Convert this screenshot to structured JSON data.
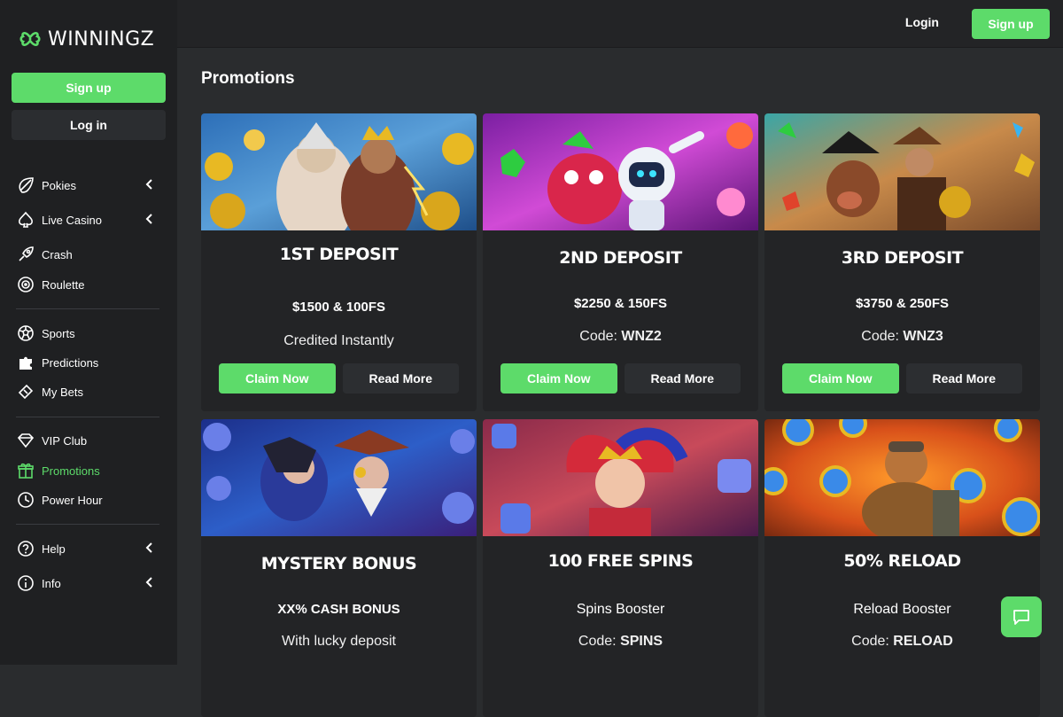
{
  "brand": {
    "name": "WINNINGZ",
    "accent": "#5ddb6a"
  },
  "sidebar": {
    "signup_label": "Sign up",
    "login_label": "Log in",
    "items": [
      {
        "label": "Pokies",
        "icon": "rocket-icon",
        "has_chevron": true
      },
      {
        "label": "Live Casino",
        "icon": "spade-icon",
        "has_chevron": true
      },
      {
        "label": "Crash",
        "icon": "rocket-launch-icon",
        "has_chevron": false
      },
      {
        "label": "Roulette",
        "icon": "roulette-icon",
        "has_chevron": false
      },
      {
        "label": "Sports",
        "icon": "soccer-ball-icon",
        "has_chevron": false
      },
      {
        "label": "Predictions",
        "icon": "puzzle-icon",
        "has_chevron": false
      },
      {
        "label": "My Bets",
        "icon": "ticket-icon",
        "has_chevron": false
      },
      {
        "label": "VIP Club",
        "icon": "diamond-icon",
        "has_chevron": false
      },
      {
        "label": "Promotions",
        "icon": "gift-icon",
        "has_chevron": false,
        "active": true
      },
      {
        "label": "Power Hour",
        "icon": "clock-icon",
        "has_chevron": false
      },
      {
        "label": "Help",
        "icon": "question-icon",
        "has_chevron": true
      },
      {
        "label": "Info",
        "icon": "info-icon",
        "has_chevron": true
      }
    ]
  },
  "header": {
    "login_label": "Login",
    "signup_label": "Sign up"
  },
  "main": {
    "title": "Promotions",
    "cards": [
      {
        "title": "1ST DEPOSIT",
        "sub": "$1500 & 100FS",
        "desc_prefix": "Credited Instantly",
        "desc_code": "",
        "claim": "Claim Now",
        "read": "Read More"
      },
      {
        "title": "2ND DEPOSIT",
        "sub": "$2250 & 150FS",
        "desc_prefix": "Code: ",
        "desc_code": "WNZ2",
        "claim": "Claim Now",
        "read": "Read More"
      },
      {
        "title": "3RD DEPOSIT",
        "sub": "$3750 & 250FS",
        "desc_prefix": "Code: ",
        "desc_code": "WNZ3",
        "claim": "Claim Now",
        "read": "Read More"
      },
      {
        "title": "MYSTERY BONUS",
        "sub": "XX% CASH BONUS",
        "desc_prefix": "With lucky deposit",
        "desc_code": ""
      },
      {
        "title": "100 FREE SPINS",
        "sub": "Spins Booster",
        "desc_prefix": "Code: ",
        "desc_code": "SPINS"
      },
      {
        "title": "50% RELOAD",
        "sub": "Reload Booster",
        "desc_prefix": "Code: ",
        "desc_code": "RELOAD"
      }
    ]
  },
  "chat": {
    "icon": "chat-bubble-icon"
  }
}
